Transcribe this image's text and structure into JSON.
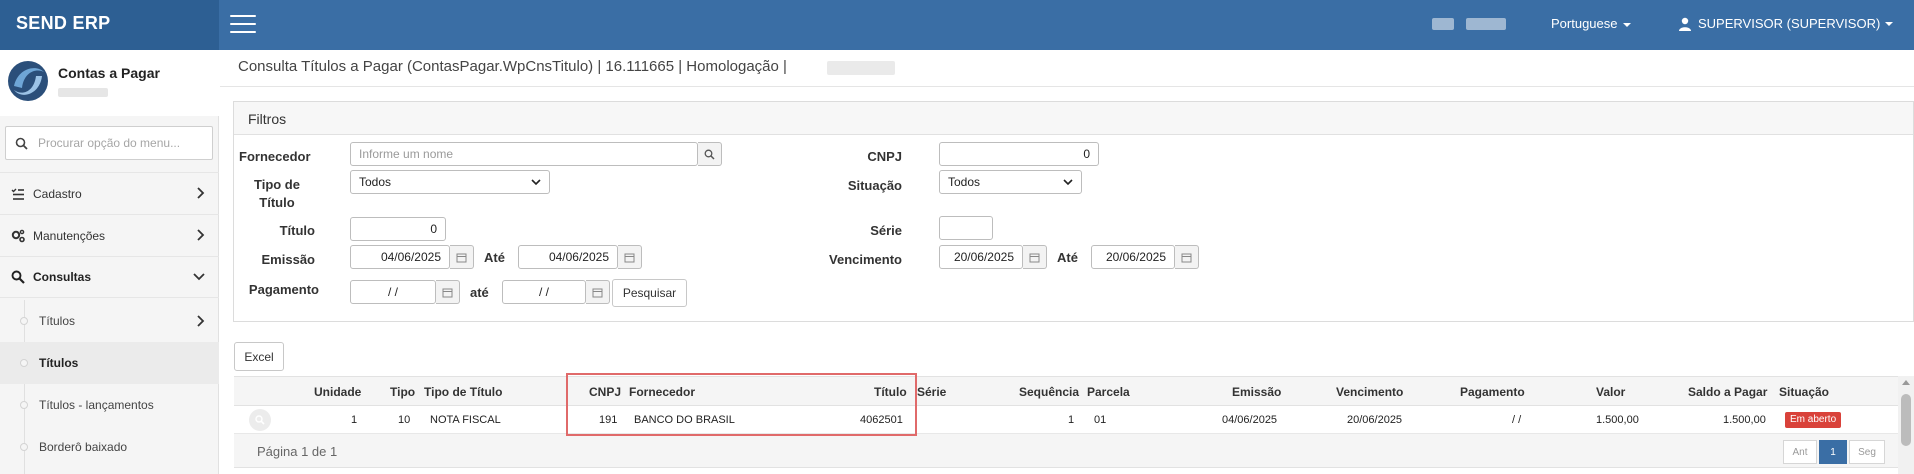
{
  "header": {
    "brand": "SEND ERP",
    "language": "Portuguese",
    "user": "SUPERVISOR (SUPERVISOR)"
  },
  "sidebar": {
    "module_title": "Contas a Pagar",
    "search_placeholder": "Procurar opção do menu...",
    "menu": [
      {
        "label": "Cadastro",
        "icon": "list-check-icon"
      },
      {
        "label": "Manutenções",
        "icon": "gears-icon"
      },
      {
        "label": "Consultas",
        "icon": "search-icon"
      }
    ],
    "submenu": [
      {
        "label": "Títulos"
      },
      {
        "label": "Títulos"
      },
      {
        "label": "Títulos - lançamentos"
      },
      {
        "label": "Borderô baixado"
      }
    ]
  },
  "page": {
    "title": "Consulta Títulos a Pagar (ContasPagar.WpCnsTitulo) | 16.111665 | Homologação |"
  },
  "filters": {
    "heading": "Filtros",
    "fornecedor_label": "Fornecedor",
    "fornecedor_placeholder": "Informe um nome",
    "tipo_titulo_label": "Tipo de Título",
    "tipo_titulo_value": "Todos",
    "titulo_label": "Título",
    "titulo_value": "0",
    "emissao_label": "Emissão",
    "emissao_from": "04/06/2025",
    "emissao_ate_label": "Até",
    "emissao_to": "04/06/2025",
    "pagamento_label": "Pagamento",
    "pagamento_from": "/ /",
    "pagamento_ate_label": "até",
    "pagamento_to": "/ /",
    "pesquisar_label": "Pesquisar",
    "cnpj_label": "CNPJ",
    "cnpj_value": "0",
    "situacao_label": "Situação",
    "situacao_value": "Todos",
    "serie_label": "Série",
    "serie_value": "",
    "vencimento_label": "Vencimento",
    "vencimento_from": "20/06/2025",
    "vencimento_ate_label": "Até",
    "vencimento_to": "20/06/2025"
  },
  "toolbar": {
    "excel_label": "Excel"
  },
  "table": {
    "columns": {
      "unidade": "Unidade",
      "tipo": "Tipo",
      "tipo_titulo": "Tipo de Título",
      "cnpj": "CNPJ",
      "fornecedor": "Fornecedor",
      "titulo": "Título",
      "serie": "Série",
      "sequencia": "Sequência",
      "parcela": "Parcela",
      "emissao": "Emissão",
      "vencimento": "Vencimento",
      "pagamento": "Pagamento",
      "valor": "Valor",
      "saldo": "Saldo a Pagar",
      "situacao": "Situação"
    },
    "rows": [
      {
        "unidade": "1",
        "tipo": "10",
        "tipo_titulo": "NOTA FISCAL",
        "cnpj": "191",
        "fornecedor": "BANCO DO BRASIL",
        "titulo": "4062501",
        "serie": "",
        "sequencia": "1",
        "parcela": "01",
        "emissao": "04/06/2025",
        "vencimento": "20/06/2025",
        "pagamento": "/ /",
        "valor": "1.500,00",
        "saldo": "1.500,00",
        "situacao": "Em aberto"
      }
    ],
    "page_info": "Página 1 de 1",
    "pager": {
      "prev": "Ant",
      "current": "1",
      "next": "Seg"
    }
  },
  "colors": {
    "topbar": "#3a6ea5",
    "brand_bg": "#2d5f93",
    "badge": "#d9423a",
    "highlight": "#e06a6a"
  }
}
